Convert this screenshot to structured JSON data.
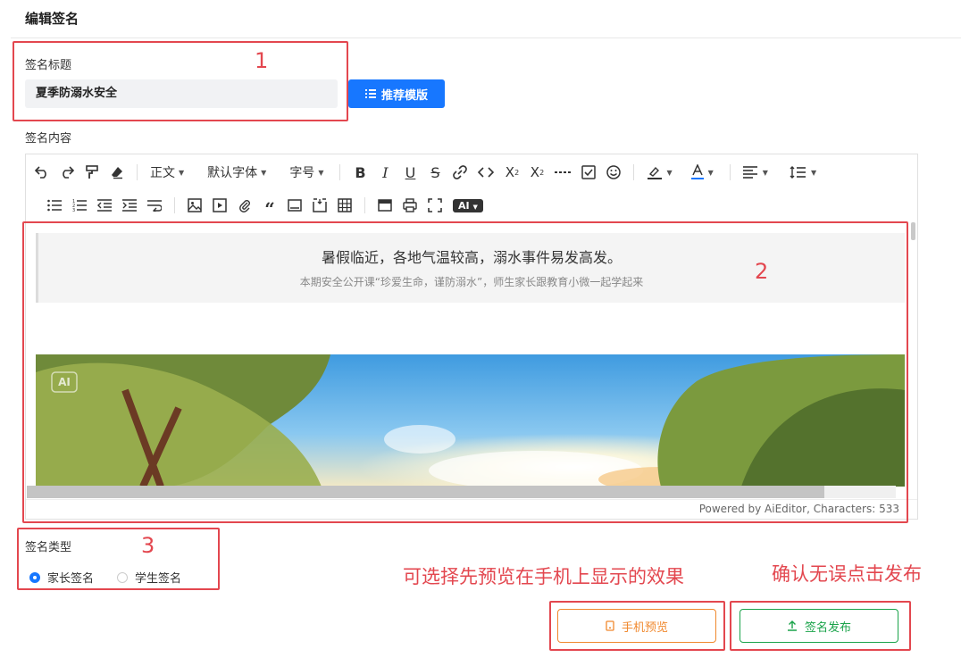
{
  "page": {
    "title": "编辑签名"
  },
  "signature_title": {
    "label": "签名标题",
    "value": "夏季防溺水安全",
    "template_button": "推荐模版"
  },
  "signature_content": {
    "label": "签名内容"
  },
  "toolbar": {
    "heading_select": "正文",
    "font_select": "默认字体",
    "size_select": "字号",
    "ai_label": "AI"
  },
  "editor": {
    "quote_main": "暑假临近，各地气温较高，溺水事件易发高发。",
    "quote_sub": "本期安全公开课“珍爱生命，谨防溺水”，师生家长跟教育小微一起学起来",
    "banner_badge": "AI",
    "footer": "Powered by AiEditor, Characters: 533"
  },
  "signature_type": {
    "label": "签名类型",
    "options": [
      {
        "label": "家长签名",
        "selected": true
      },
      {
        "label": "学生签名",
        "selected": false
      }
    ]
  },
  "annotations": {
    "n1": "1",
    "n2": "2",
    "n3": "3",
    "preview_hint": "可选择先预览在手机上显示的效果",
    "publish_hint": "确认无误点击发布"
  },
  "actions": {
    "preview": "手机预览",
    "publish": "签名发布"
  },
  "colors": {
    "primary": "#1777ff",
    "annotation_red": "#e3474f",
    "preview_orange": "#f0882d",
    "publish_green": "#1aa34a"
  }
}
